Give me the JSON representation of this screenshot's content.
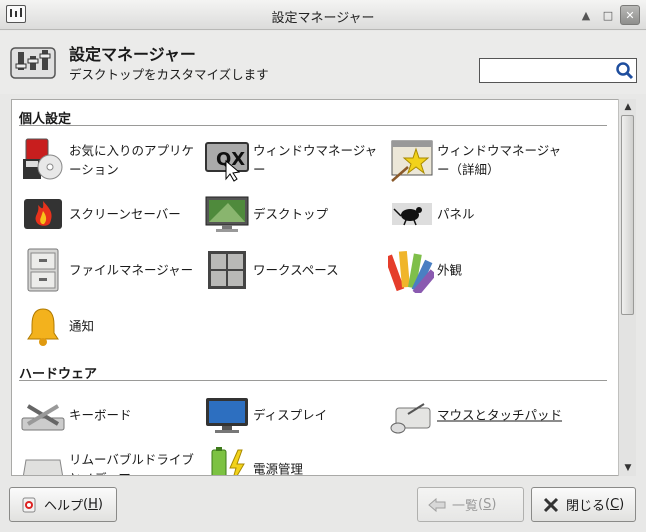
{
  "window": {
    "title": "設定マネージャー"
  },
  "header": {
    "title": "設定マネージャー",
    "subtitle": "デスクトップをカスタマイズします"
  },
  "search": {
    "value": "",
    "placeholder": ""
  },
  "sections": [
    {
      "title": "個人設定"
    },
    {
      "title": "ハードウェア"
    }
  ],
  "items": {
    "favorite_apps": "お気に入りのアプリケーション",
    "window_manager": "ウィンドウマネージャー",
    "window_manager_tweaks": "ウィンドウマネージャー（詳細）",
    "screensaver": "スクリーンセーバー",
    "desktop": "デスクトップ",
    "panel": "パネル",
    "file_manager": "ファイルマネージャー",
    "workspaces": "ワークスペース",
    "appearance": "外観",
    "notifications": "通知",
    "keyboard": "キーボード",
    "display": "ディスプレイ",
    "mouse_touchpad": "マウスとタッチパッド",
    "removable_drives": "リムーバブルドライブとメディア",
    "power_manager": "電源管理"
  },
  "buttons": {
    "help": "ヘルプ",
    "help_key": "H",
    "all": "一覧",
    "all_key": "S",
    "close": "閉じる",
    "close_key": "C"
  }
}
